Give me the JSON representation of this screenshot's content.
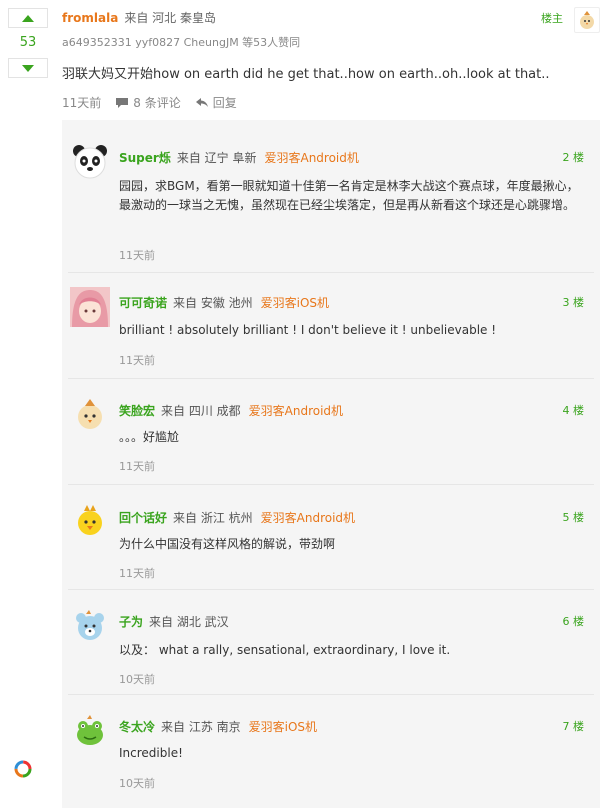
{
  "main": {
    "votes": "53",
    "username": "fromlala",
    "location": "来自 河北 秦皇岛",
    "op_label": "楼主",
    "likers": "a649352331 yyf0827 CheungJM 等53人赞同",
    "text": "羽联大妈又开始how on earth did he get that..how on earth..oh..look at that..",
    "time": "11天前",
    "comments": "8 条评论",
    "reply_label": "回复"
  },
  "replies": [
    {
      "name": "Super烁",
      "location": "来自 辽宁 阜新",
      "app": "爱羽客Android机",
      "floor": "2 楼",
      "text": "园园，求BGM，看第一眼就知道十佳第一名肯定是林李大战这个赛点球，年度最揪心，最激动的一球当之无愧，虽然现在已经尘埃落定，但是再从新看这个球还是心跳骤增。",
      "time": "11天前",
      "avatar": "panda-avatar"
    },
    {
      "name": "可可奇诺",
      "location": "来自 安徽 池州",
      "app": "爱羽客iOS机",
      "floor": "3 楼",
      "text": "brilliant ! absolutely brilliant ! I don't believe it ! unbelievable !",
      "time": "11天前",
      "avatar": "anime-girl-avatar"
    },
    {
      "name": "笑脸宏",
      "location": "来自 四川 成都",
      "app": "爱羽客Android机",
      "floor": "4 楼",
      "text": "。。。好尴尬",
      "time": "11天前",
      "avatar": "chick-avatar"
    },
    {
      "name": "回个话好",
      "location": "来自 浙江 杭州",
      "app": "爱羽客Android机",
      "floor": "5 楼",
      "text": "为什么中国没有这样风格的解说，带劲啊",
      "time": "11天前",
      "avatar": "chick-avatar"
    },
    {
      "name": "子为",
      "location": "来自 湖北 武汉",
      "app": "",
      "floor": "6 楼",
      "text": "以及： what a rally, sensational, extraordinary, I love it.",
      "time": "10天前",
      "avatar": "bear-avatar"
    },
    {
      "name": "冬太冷",
      "location": "来自 江苏 南京",
      "app": "爱羽客iOS机",
      "floor": "7 楼",
      "text": "Incredible!",
      "time": "10天前",
      "avatar": "frog-avatar"
    }
  ],
  "colors": {
    "green": "#3aa41e",
    "orange": "#e8771b",
    "panel": "#f5f5f5"
  }
}
